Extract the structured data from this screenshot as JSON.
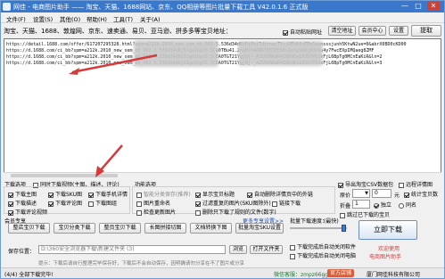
{
  "titlebar": {
    "title": "网佳 - 电商图片助手 —— 淘宝、天猫、1688网站、京东、QQ相册等图片批量下载工具 V42.0.1.6 正式版",
    "min": "—",
    "max": "□",
    "close": "✕"
  },
  "menu": {
    "items": [
      "文件(F)",
      "设置(S)",
      "其他(O)",
      "帮助(H)",
      "工具(T)",
      "关于(A)"
    ]
  },
  "address": {
    "label": "淘宝、天猫、1688、敦煌网、京东、速卖通、易贝、亚马逊、拼多多等宝贝地址：",
    "auto_paste": "自动粘贴网址",
    "clear": "清空地址",
    "member_center": "会员中心",
    "settings": "设置",
    "extract": "提取"
  },
  "urls": [
    "https://detail.1688.com/offer/617207295328.html?spm=a212k.2010_new_sem_dh_002.5.536d34d8tPj6hiTdtrnarTXrjUEbHfeEEmSwwnsssjunh5KtwN2ue=0&abrX0BD0cKD00",
    "https://d.1688.com/ci_bb?spm=a212k.2010_new_sem_dh_002.5.536d34d8j51ge1Ggl0.5Ca0TBu41.2xqMJ0A6MGTEBTEE16vZalp9A6j0dO9u4y7FwcEXpIMQaeg8ZMF",
    "https://d.1688.com/ci_bb?spm=a212k.2010_new_sem_dh_002.5.536d34d8j51ge1Ggl0.5CEA0TGT21Ygj8j-_AZ1HSRKwR4Z8DQEa1XU57P5JxFjL6BpTg0MCnEaKiR&ln=2",
    "https://d.1688.com/ci_bb?spm=a212k.2010_new_sem_dh_002.5.536d34d8j51ge1Ggl0.5CEA0TGT21Ygj8j-_AZ1HSRKwR4Z8DQEa1XU57P5JxFjL6BpTg0MCnEaKiR&ln=3"
  ],
  "options": {
    "section_download": "下载选项",
    "download_video": "同时下载视频(主图、描述、评论)",
    "section_features": "功能选项",
    "export_csv": "导出淘宝CSV数据包",
    "remote_detail": "远程详情图",
    "main_image": "下载主图",
    "sku_image": "下载SKU图",
    "desc_image": "下载描述",
    "review_image": "下载评论图",
    "review_video": "下载评论视频",
    "mobile_desc": "下载手机详情",
    "group_images": "下载图组",
    "smart_share": "智能分类保存(推荐)",
    "show_shop": "显示宝贝标题",
    "auto_remove": "自动删除详情页中的外链",
    "rename_image": "图片重命名",
    "link_download": "链接下载",
    "check_update": "检查更新图片",
    "filter_dup": "过滤重复的图片(SKU图除外)",
    "keep_only": "删除只下载了规则的文件(数字)",
    "stats": "统计宝贝数",
    "skip_downloaded": "跳过已下载的宝贝",
    "price_label": "原价",
    "price_value": "0",
    "unit": "元",
    "fold": "折叠",
    "fold_value": "1",
    "alone": "独立",
    "same_name": "同名"
  },
  "member": {
    "section": "会员专享",
    "more_settings": "更多专享设置>>",
    "speed_label": "批量下载速度：",
    "speed_value": "(最快)",
    "buttons": [
      "整店宝贝下载",
      "宝贝分类下载",
      "整页宝贝下载",
      "长图拼接切图",
      "文档转换下图",
      "批量淘宝SKU设置"
    ],
    "auto_shutdown": "下载完成后自动关闭软件",
    "auto_hibernate": "下载完成后自动关闭电脑"
  },
  "save": {
    "label": "保存位置：",
    "path": "D:\\360安全浏览器下载\\新建文件夹 (3)",
    "browse": "浏览",
    "open_folder": "打开文件夹",
    "hint": "提示：下载后请自行整理完毕保存好，下载后不会自动保存，因明确请勿分享在不了图片或分享",
    "start": "立即下载",
    "welcome": "欢迎使用",
    "product": "电商图片助手"
  },
  "status": {
    "left": "(4/4) 全部下载完毕!",
    "wechat": "微信客服：zmpz66gg",
    "shop": "官方店铺",
    "company": "厦门网佳科技有限公司"
  }
}
